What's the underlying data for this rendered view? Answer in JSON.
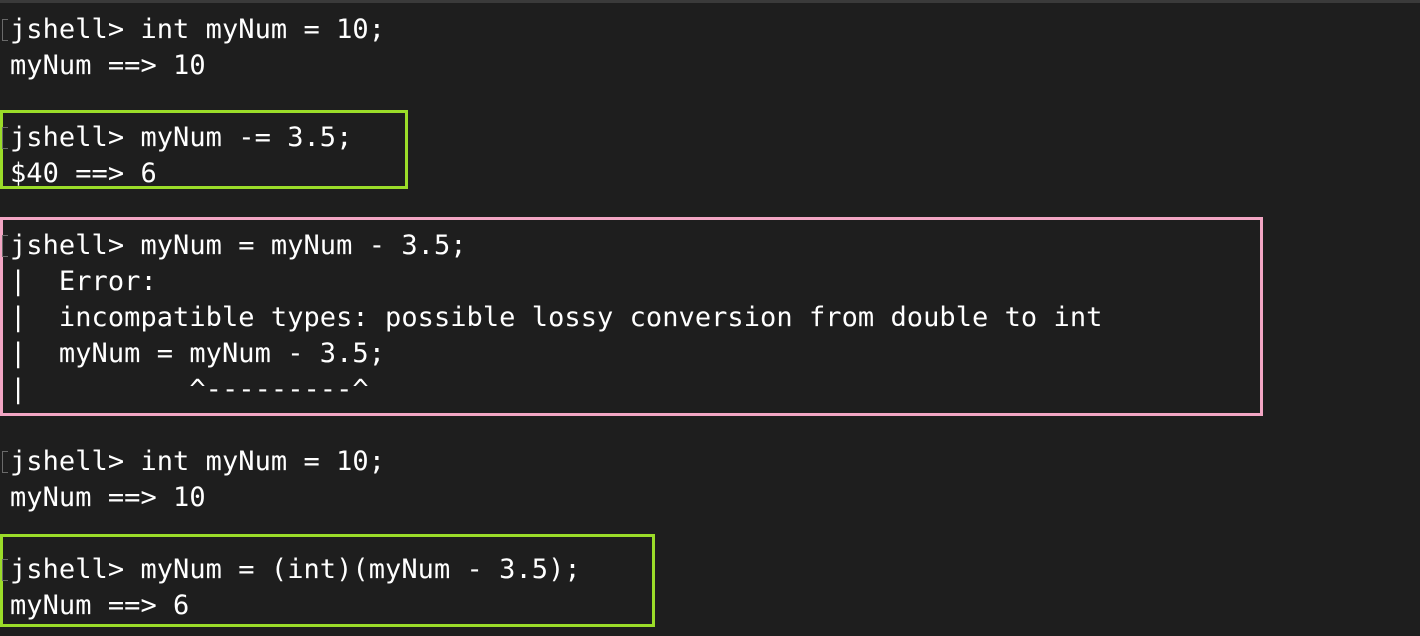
{
  "terminal": {
    "accent_success": "#9bdc29",
    "accent_error": "#f3a6c4",
    "lines": [
      "jshell> int myNum = 10;",
      "myNum ==> 10",
      "jshell> myNum -= 3.5;",
      "$40 ==> 6",
      "jshell> myNum = myNum - 3.5;",
      "|  Error:",
      "|  incompatible types: possible lossy conversion from double to int",
      "|  myNum = myNum - 3.5;",
      "|          ^---------^",
      "jshell> int myNum = 10;",
      "myNum ==> 10",
      "jshell> myNum = (int)(myNum - 3.5);",
      "myNum ==> 6"
    ]
  }
}
